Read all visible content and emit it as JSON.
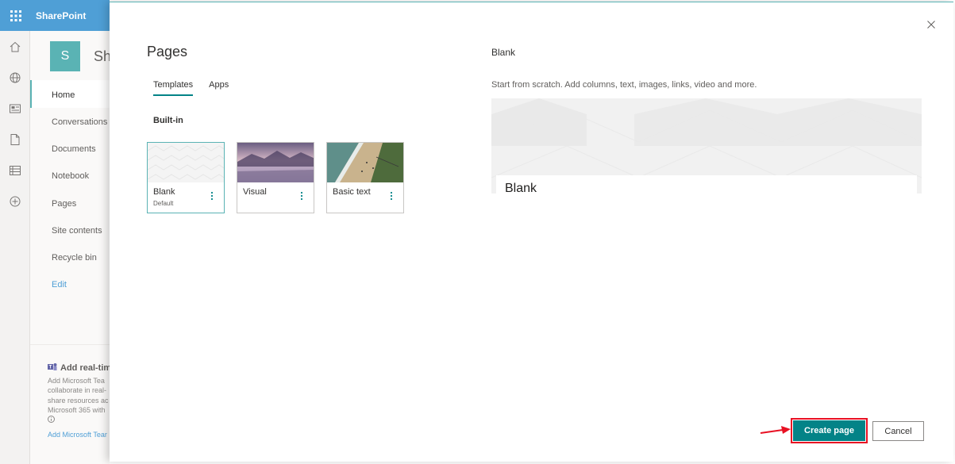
{
  "suitebar": {
    "brand": "SharePoint",
    "waffle_icon": "waffle-icon"
  },
  "appbar": {
    "icons": [
      "home-icon",
      "globe-icon",
      "news-icon",
      "file-icon",
      "list-icon",
      "add-circle-icon"
    ]
  },
  "site": {
    "logo_letter": "S",
    "title": "Sh",
    "nav": [
      "Home",
      "Conversations",
      "Documents",
      "Notebook",
      "Pages",
      "Site contents",
      "Recycle bin"
    ],
    "edit_label": "Edit",
    "teams": {
      "title": "Add real-tim",
      "lines": [
        "Add Microsoft Tea",
        "collaborate in real-",
        "share resources ac",
        "Microsoft 365 with"
      ],
      "link": "Add Microsoft Tear"
    }
  },
  "panel": {
    "title": "Pages",
    "tabs": [
      "Templates",
      "Apps"
    ],
    "section_label": "Built-in",
    "templates": [
      {
        "name": "Blank",
        "sub": "Default"
      },
      {
        "name": "Visual",
        "sub": ""
      },
      {
        "name": "Basic text",
        "sub": ""
      }
    ],
    "preview": {
      "title": "Blank",
      "description": "Start from scratch. Add columns, text, images, links, video and more.",
      "card_title": "Blank"
    },
    "create_label": "Create page",
    "cancel_label": "Cancel"
  },
  "colors": {
    "accent": "#038387",
    "suitebar": "#4f9fd6",
    "highlight": "#e81123"
  }
}
